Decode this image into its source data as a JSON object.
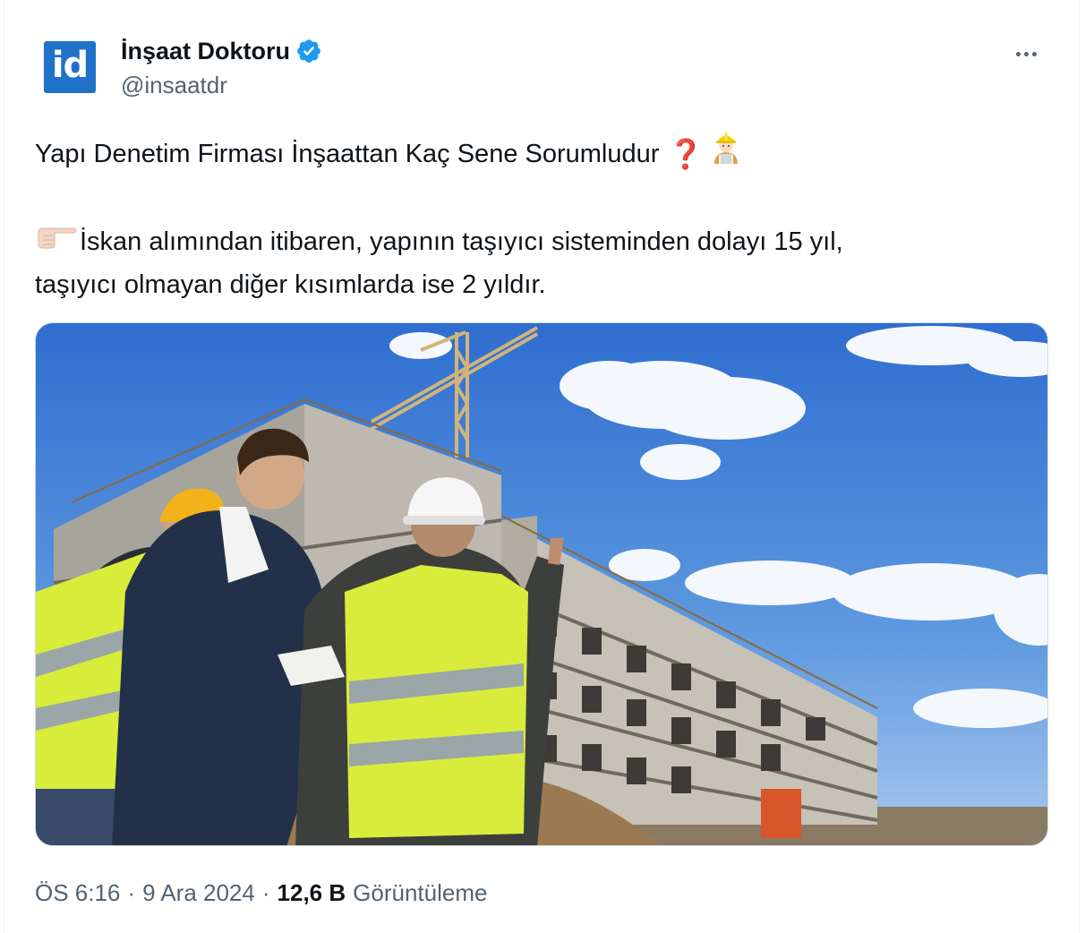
{
  "author": {
    "avatar_text": "id",
    "display_name": "İnşaat Doktoru",
    "handle": "@insaatdr",
    "verified": true,
    "verified_color": "#1d9bf0"
  },
  "tweet": {
    "line1": "Yapı Denetim Firması İnşaattan Kaç Sene Sorumludur",
    "line1_emoji_question": "❓",
    "line1_emoji_worker": "construction-worker-emoji",
    "line2": "İskan alımından itibaren, yapının taşıyıcı sisteminden dolayı 15 yıl,",
    "line2_emoji": "pointing-right-emoji",
    "line3": "taşıyıcı olmayan diğer kısımlarda ise 2 yıldır."
  },
  "media": {
    "image": "construction-site-photo"
  },
  "footer": {
    "time": "ÖS 6:16",
    "separator1": "·",
    "date": "9 Ara 2024",
    "separator2": "·",
    "views_count": "12,6 B",
    "views_label": "Görüntüleme"
  },
  "icons": {
    "more": "more-options-icon",
    "verified": "verified-badge-icon"
  },
  "colors": {
    "text": "#0f1419",
    "secondary": "#536471",
    "brand_avatar": "#1f72c8",
    "border": "#cfd9de"
  }
}
